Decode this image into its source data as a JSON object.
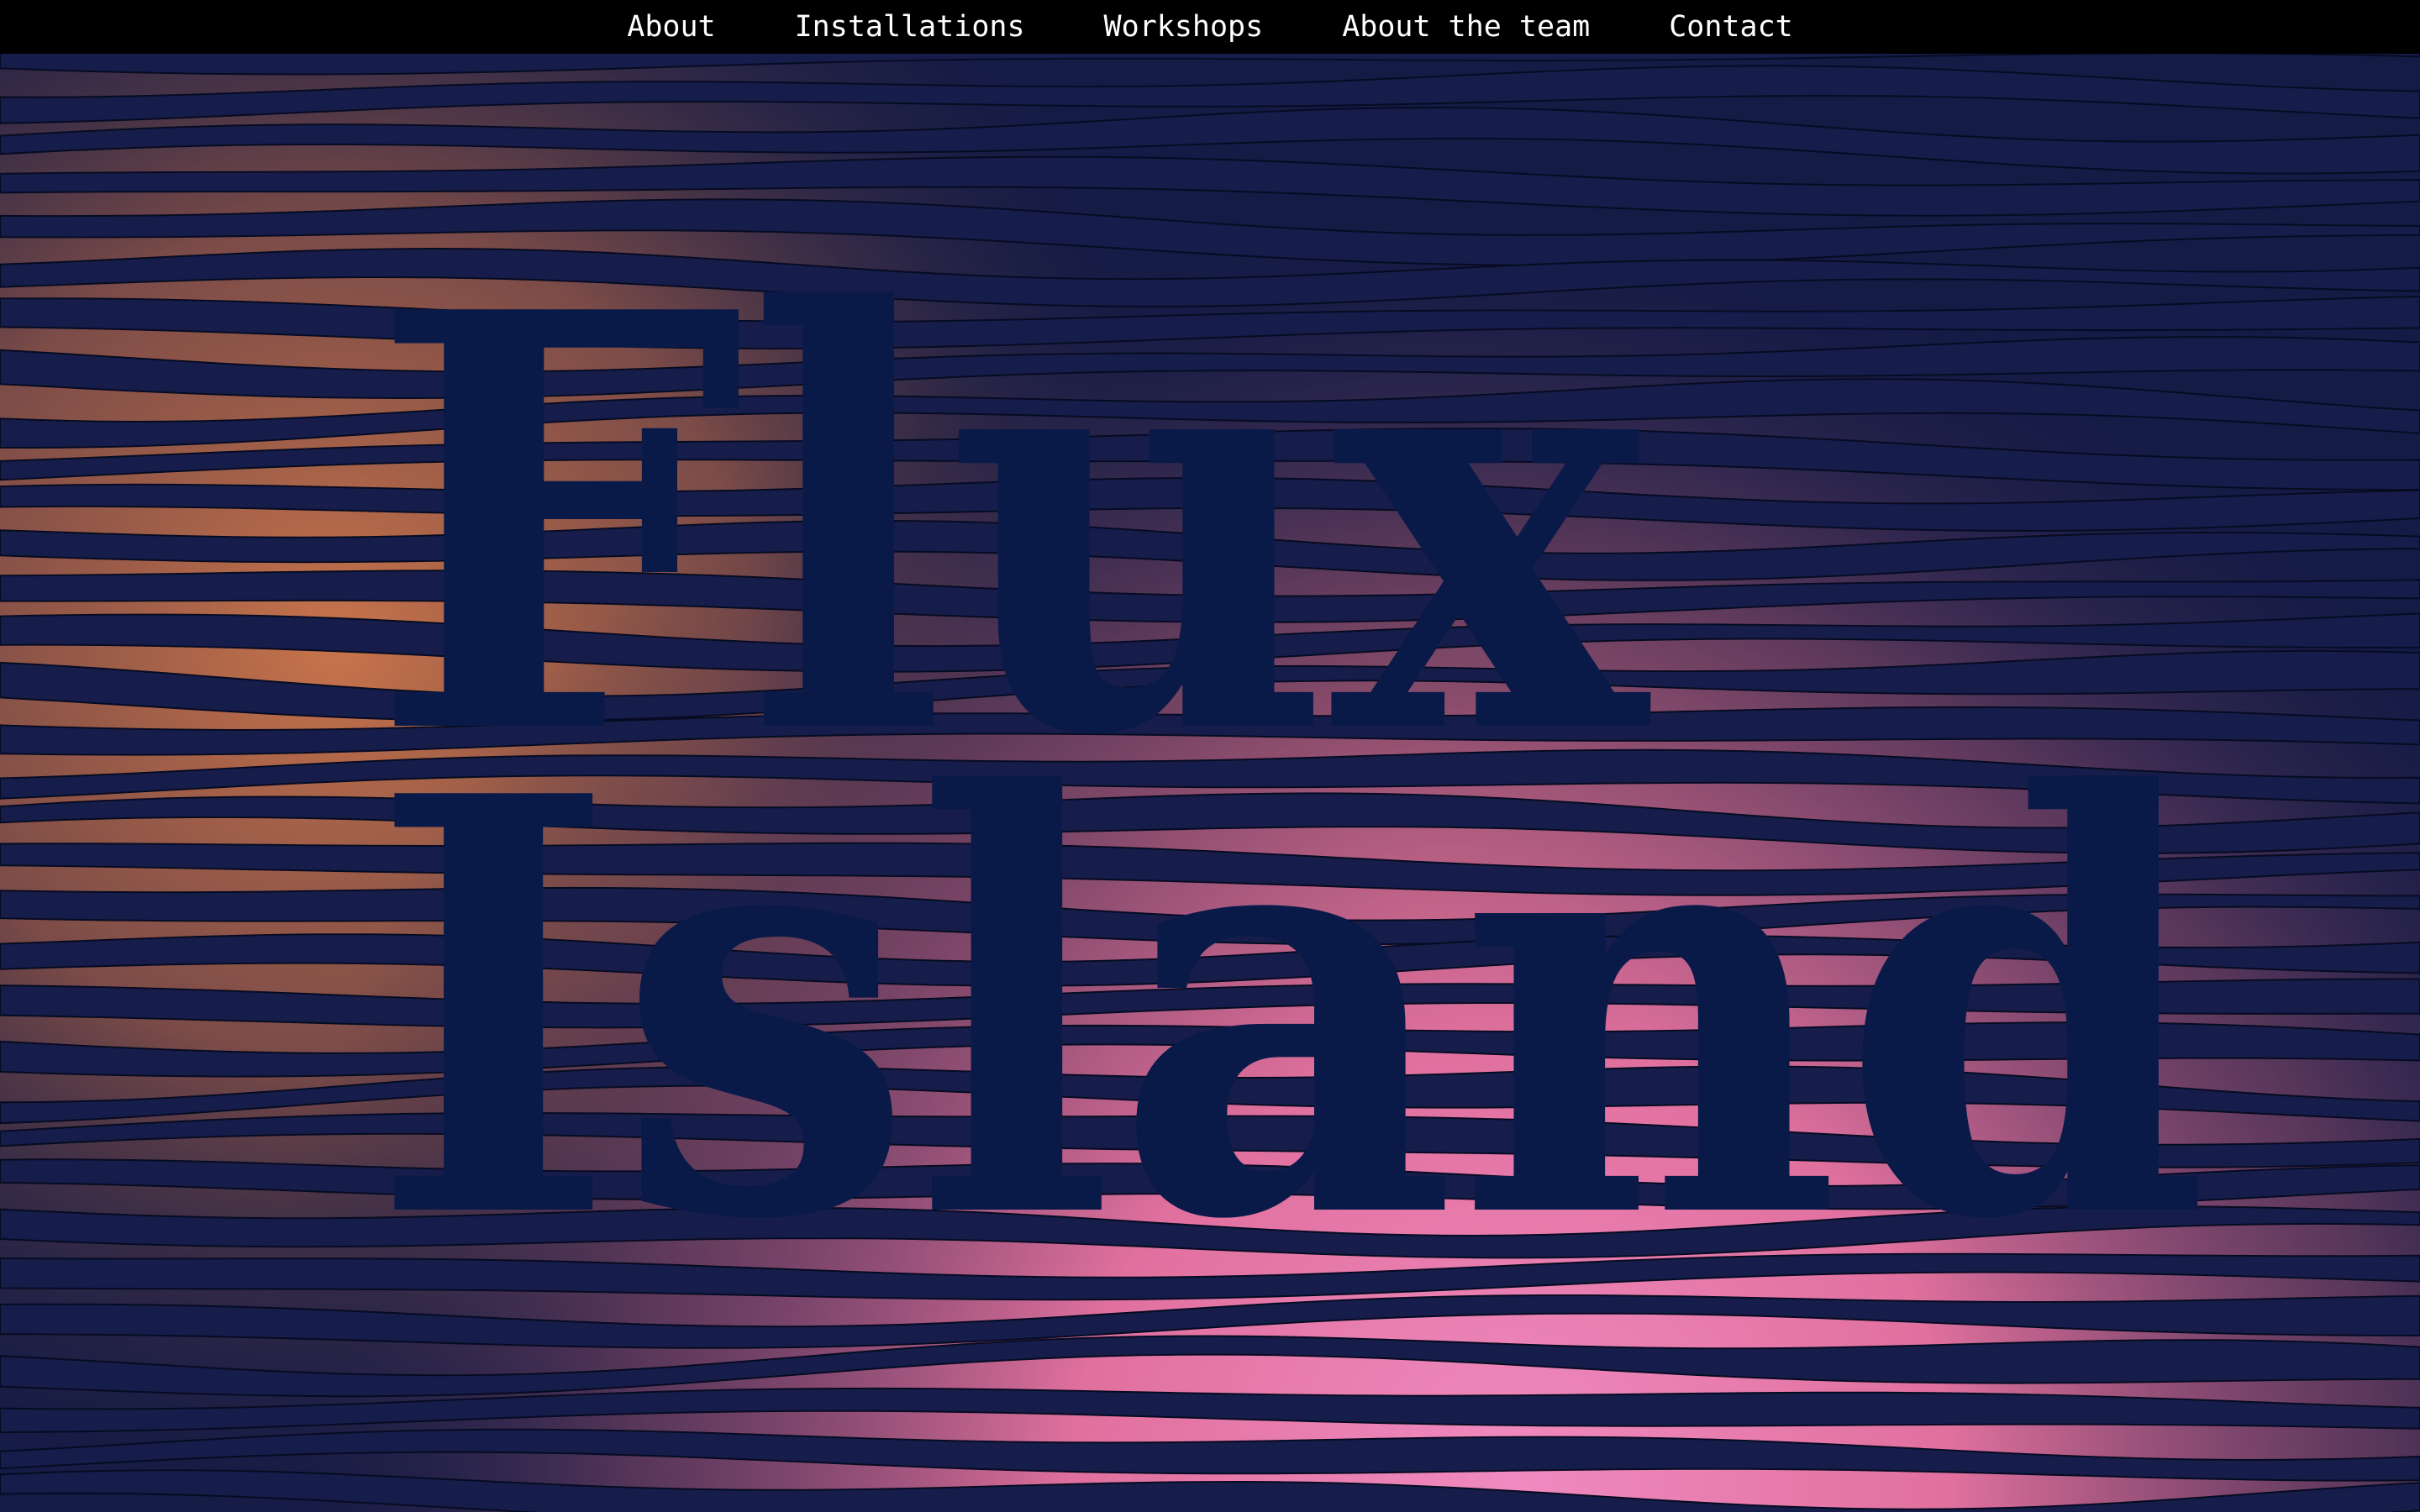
{
  "nav": {
    "items": [
      {
        "label": "About"
      },
      {
        "label": "Installations"
      },
      {
        "label": "Workshops"
      },
      {
        "label": "About the team"
      },
      {
        "label": "Contact"
      }
    ]
  },
  "hero": {
    "title_line_1": "Flux",
    "title_line_2": "Island"
  },
  "colors": {
    "nav_background": "#000000",
    "nav_text": "#ffffff",
    "background_navy": "#141b45",
    "title_navy": "#0a1a48",
    "glow_orange": "#c8744a",
    "glow_pink": "#f08ac0"
  }
}
